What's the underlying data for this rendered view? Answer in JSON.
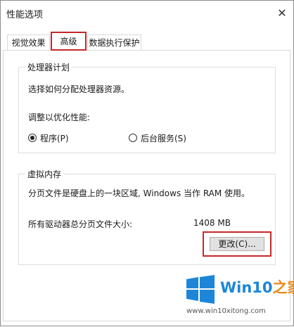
{
  "window": {
    "title": "性能选项"
  },
  "tabs": [
    {
      "label": "视觉效果"
    },
    {
      "label": "高级"
    },
    {
      "label": "数据执行保护"
    }
  ],
  "processor": {
    "group_title": "处理器计划",
    "description": "选择如何分配处理器资源。",
    "optimize_label": "调整以优化性能:",
    "option_programs": "程序(P)",
    "option_services": "后台服务(S)",
    "selected": "程序(P)"
  },
  "virtual_memory": {
    "group_title": "虚拟内存",
    "description": "分页文件是硬盘上的一块区域, Windows 当作 RAM 使用。",
    "total_label": "所有驱动器总分页文件大小:",
    "total_value": "1408 MB",
    "change_button": "更改(C)..."
  },
  "watermark": {
    "brand_main": "Win10",
    "brand_accent": "之家",
    "url": "www.win10xitong.com"
  },
  "colors": {
    "highlight_red": "#c62828",
    "brand_blue": "#1d86d8",
    "brand_orange": "#e88a1a"
  }
}
